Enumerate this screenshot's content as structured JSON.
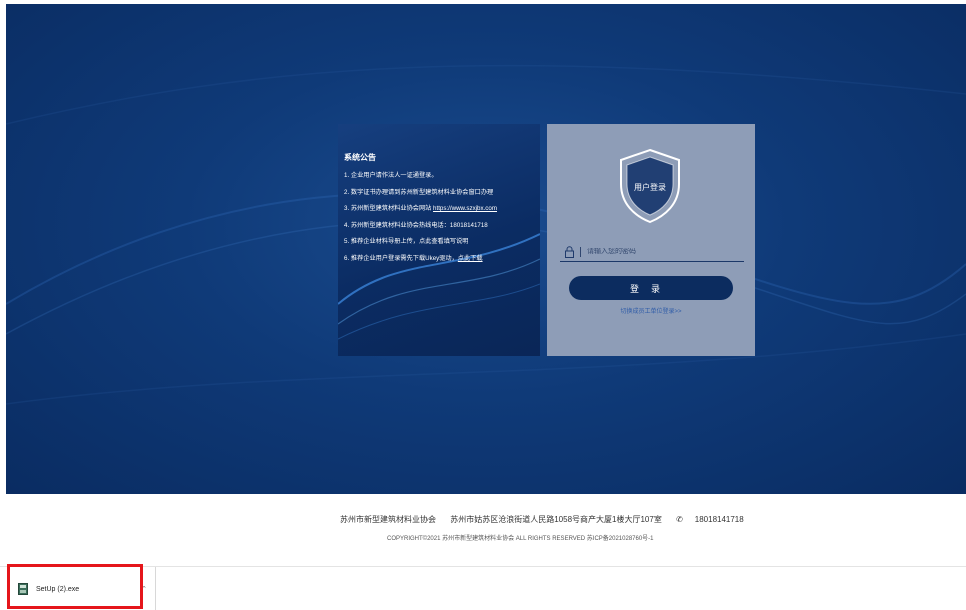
{
  "notice": {
    "title": "系统公告",
    "items": [
      "1. 企业用户请作法人一证通登录。",
      "2. 数字证书办理请到苏州新型建筑材料业协会窗口办理",
      "3. 苏州新型建筑材料业协会网站 ",
      "4. 苏州新型建筑材料业协会热线电话：18018141718",
      "5. 推荐企业材料导册上传，点此查看填写说明",
      "6. 推荐企业用户登录需先下载Ukey驱动，"
    ],
    "website": "https://www.szxjbx.com",
    "download_link": "点此下载"
  },
  "login": {
    "shield_label": "用户登录",
    "password_placeholder": "请输入您的密码",
    "submit_label": "登录",
    "switch_link": "切换成员工单位登录>>"
  },
  "footer": {
    "org_name": "苏州市新型建筑材料业协会",
    "address": "苏州市姑苏区沧浪街道人民路1058号商产大厦1楼大厅107室",
    "phone": "18018141718",
    "copyright": "COPYRIGHT©2021 苏州市新型建筑材料业协会 ALL RIGHTS RESERVED 苏ICP备2021028760号-1"
  },
  "download_bar": {
    "file_name": "SetUp (2).exe"
  },
  "colors": {
    "hero_bg": "#0f3a78",
    "login_panel": "#8e9db7",
    "button": "#0c2c5f",
    "highlight": "#e5161b"
  }
}
